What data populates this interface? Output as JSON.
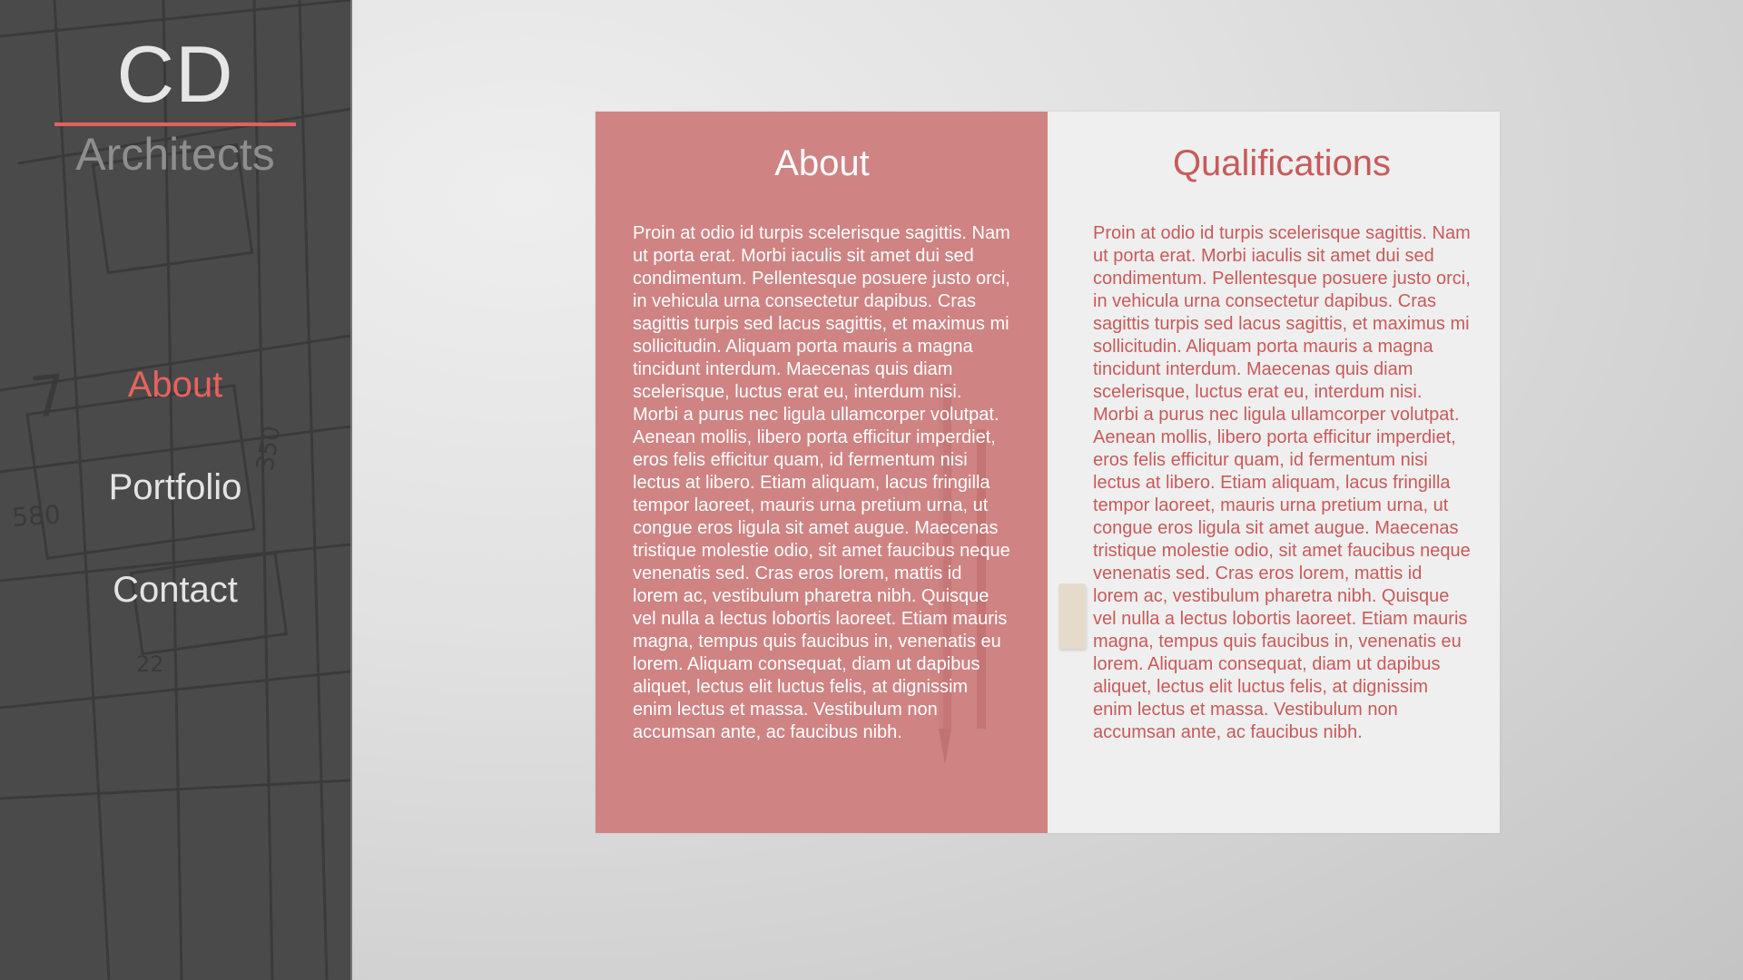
{
  "brand": {
    "initials": "CD",
    "name": "Architects"
  },
  "nav": {
    "items": [
      {
        "label": "About",
        "active": true
      },
      {
        "label": "Portfolio",
        "active": false
      },
      {
        "label": "Contact",
        "active": false
      }
    ]
  },
  "about": {
    "title": "About",
    "body": "Proin at odio id turpis scelerisque sagittis. Nam ut porta erat. Morbi iaculis sit amet dui sed condimentum. Pellentesque posuere justo orci, in vehicula urna consectetur dapibus. Cras sagittis turpis sed lacus sagittis, et maximus mi sollicitudin. Aliquam porta mauris a magna tincidunt interdum. Maecenas quis diam scelerisque, luctus erat eu, interdum nisi. Morbi a purus nec ligula ullamcorper volutpat. Aenean mollis, libero porta efficitur imperdiet, eros felis efficitur quam, id fermentum nisi lectus at libero. Etiam aliquam, lacus fringilla tempor laoreet, mauris urna pretium urna, ut congue eros ligula sit amet augue. Maecenas tristique molestie odio, sit amet faucibus neque venenatis sed. Cras eros lorem, mattis id lorem ac, vestibulum pharetra nibh. Quisque vel nulla a lectus lobortis laoreet. Etiam mauris magna, tempus quis faucibus in, venenatis eu lorem. Aliquam consequat, diam ut dapibus aliquet, lectus elit luctus felis, at dignissim enim lectus et massa. Vestibulum non accumsan ante, ac faucibus nibh."
  },
  "qualifications": {
    "title": "Qualifications",
    "body": "Proin at odio id turpis scelerisque sagittis. Nam ut porta erat. Morbi iaculis sit amet dui sed condimentum. Pellentesque posuere justo orci, in vehicula urna consectetur dapibus. Cras sagittis turpis sed lacus sagittis, et maximus mi sollicitudin. Aliquam porta mauris a magna tincidunt interdum. Maecenas quis diam scelerisque, luctus erat eu, interdum nisi. Morbi a purus nec ligula ullamcorper volutpat. Aenean mollis, libero porta efficitur imperdiet, eros felis efficitur quam, id fermentum nisi lectus at libero. Etiam aliquam, lacus fringilla tempor laoreet, mauris urna pretium urna, ut congue eros ligula sit amet augue. Maecenas tristique molestie odio, sit amet faucibus neque venenatis sed. Cras eros lorem, mattis id lorem ac, vestibulum pharetra nibh. Quisque vel nulla a lectus lobortis laoreet. Etiam mauris magna, tempus quis faucibus in, venenatis eu lorem. Aliquam consequat, diam ut dapibus aliquet, lectus elit luctus felis, at dignissim enim lectus et massa. Vestibulum non accumsan ante, ac faucibus nibh."
  },
  "colors": {
    "accent": "#e86260",
    "about_panel": "#cf8383",
    "qualifications_panel": "#efefef",
    "qualifications_text": "#c85a5a",
    "sidebar": "#4a4a4a"
  }
}
